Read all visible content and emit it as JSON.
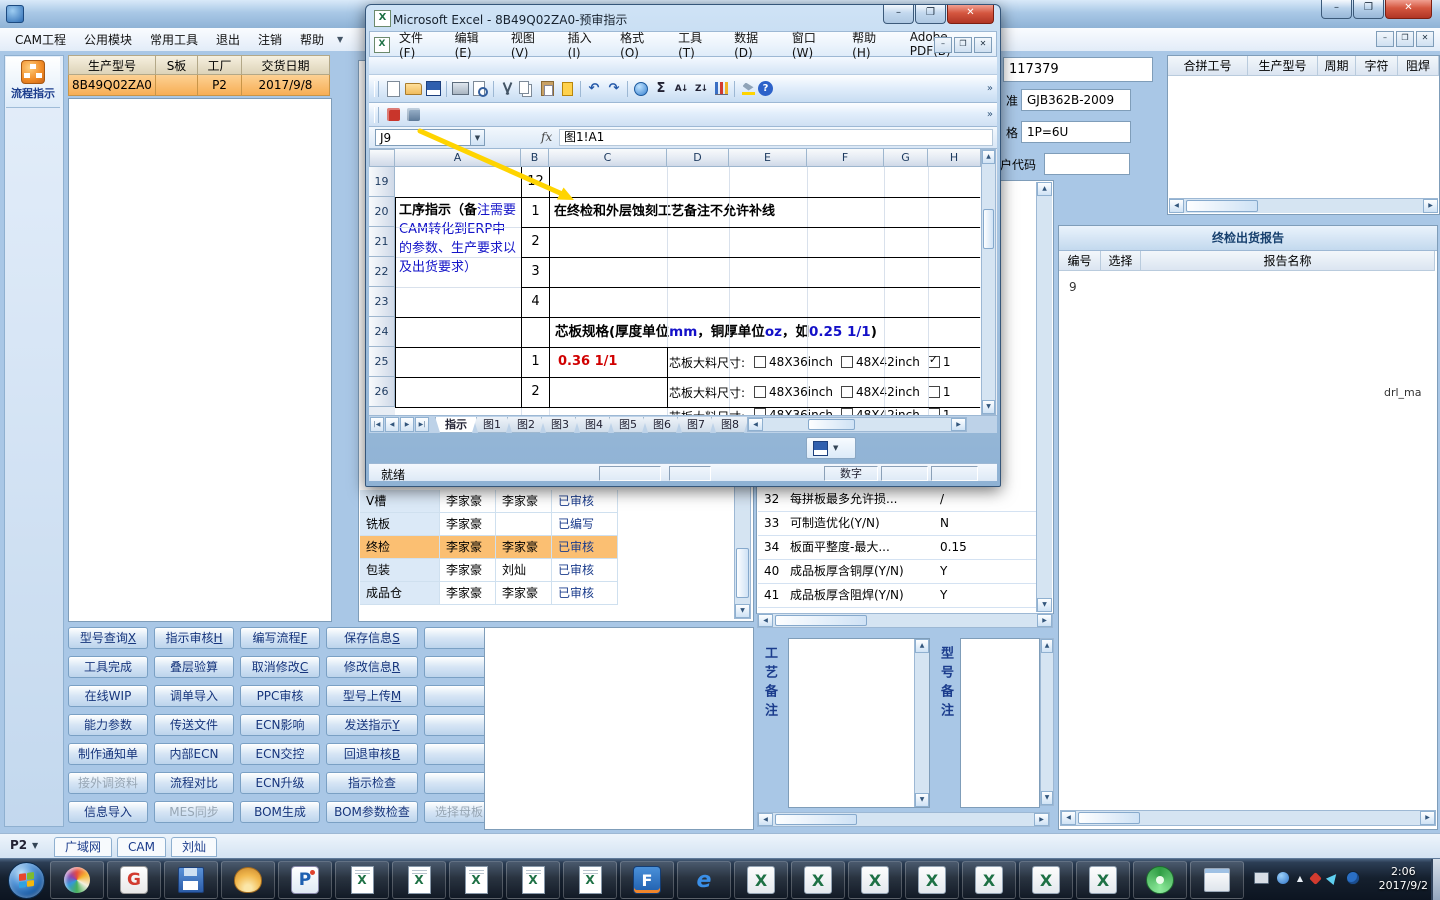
{
  "app": {
    "window_buttons": {
      "minimize": "–",
      "maximize": "❐",
      "close": "✕"
    },
    "menu": [
      "CAM工程",
      "公用模块",
      "常用工具",
      "退出",
      "注销",
      "帮助"
    ],
    "sidebar_flow_label": "流程指示",
    "order_table": {
      "headers": [
        "生产型号",
        "S板",
        "工厂",
        "交货日期"
      ],
      "row": {
        "model": "8B49Q02ZA0",
        "s_board": "",
        "factory": "P2",
        "delivery_date": "2017/9/8"
      }
    },
    "process_table": {
      "rows": [
        {
          "step": "V槽",
          "writer": "李家豪",
          "auditor": "李家豪",
          "status": "已审核",
          "highlight": false
        },
        {
          "step": "铣板",
          "writer": "李家豪",
          "auditor": "",
          "status": "已编写",
          "highlight": false
        },
        {
          "step": "终检",
          "writer": "李家豪",
          "auditor": "李家豪",
          "status": "已审核",
          "highlight": true
        },
        {
          "step": "包装",
          "writer": "李家豪",
          "auditor": "刘灿",
          "status": "已审核",
          "highlight": false
        },
        {
          "step": "成品仓",
          "writer": "李家豪",
          "auditor": "李家豪",
          "status": "已审核",
          "highlight": false
        }
      ]
    },
    "params_table": {
      "rows": [
        {
          "no": "32",
          "name": "每拼板最多允许损...",
          "value": "/"
        },
        {
          "no": "33",
          "name": "可制造优化(Y/N)",
          "value": "N"
        },
        {
          "no": "34",
          "name": "板面平整度-最大...",
          "value": "0.15"
        },
        {
          "no": "40",
          "name": "成品板厚含铜厚(Y/N)",
          "value": "Y"
        },
        {
          "no": "41",
          "name": "成品板厚含阻焊(Y/N)",
          "value": "Y"
        }
      ]
    },
    "fields": {
      "order_no": "117379",
      "standard_label": "准",
      "standard_value": "GJB362B-2009",
      "spec_label": "格",
      "spec_value": "1P=6U",
      "customer_label": "户代码",
      "customer_value": ""
    },
    "merge_table_headers": [
      "合拼工号",
      "生产型号",
      "周期",
      "字符",
      "阻焊"
    ],
    "report_panel": {
      "title": "终检出货报告",
      "headers": [
        "编号",
        "选择",
        "报告名称"
      ],
      "fragment_no": "9",
      "fragment_name": "drl_ma"
    },
    "buttons": [
      [
        "型号查询X",
        "指示审核H",
        "编写流程F",
        "保存信息S",
        ""
      ],
      [
        "工具完成",
        "叠层验算",
        "取消修改C",
        "修改信息R",
        ""
      ],
      [
        "在线WIP",
        "调单导入",
        "PPC审核",
        "型号上传M",
        ""
      ],
      [
        "能力参数",
        "传送文件",
        "ECN影响",
        "发送指示Y",
        ""
      ],
      [
        "制作通知单",
        "内部ECN",
        "ECN交控",
        "回退审核B",
        ""
      ],
      [
        "接外调资料",
        "流程对比",
        "ECN升级",
        "指示检查",
        ""
      ],
      [
        "信息导入",
        "MES同步",
        "BOM生成",
        "BOM参数检查",
        "选择母板"
      ]
    ],
    "disabled_buttons": [
      "接外调资料",
      "MES同步",
      "选择母板"
    ],
    "remark_labels": {
      "process": "工艺备注",
      "model": "型号备注"
    },
    "bottom_bar": {
      "site": "P2",
      "tabs": [
        "广域网",
        "CAM",
        "刘灿"
      ]
    }
  },
  "excel": {
    "title": "Microsoft Excel - 8B49Q02ZA0-预审指示",
    "menus": [
      "文件(F)",
      "编辑(E)",
      "视图(V)",
      "插入(I)",
      "格式(O)",
      "工具(T)",
      "数据(D)",
      "窗口(W)",
      "帮助(H)",
      "Adobe PDF(B)"
    ],
    "toolbar_icons": [
      {
        "n": "new"
      },
      {
        "n": "open"
      },
      {
        "n": "save"
      },
      {
        "n": "sep"
      },
      {
        "n": "print"
      },
      {
        "n": "print-preview"
      },
      {
        "n": "sep"
      },
      {
        "n": "cut"
      },
      {
        "n": "copy"
      },
      {
        "n": "paste"
      },
      {
        "n": "format-painter"
      },
      {
        "n": "sep"
      },
      {
        "n": "undo",
        "g": "↶"
      },
      {
        "n": "redo",
        "g": "↷"
      },
      {
        "n": "sep"
      },
      {
        "n": "hyperlink"
      },
      {
        "n": "autosum",
        "g": "Σ"
      },
      {
        "n": "sort-asc",
        "g": "A↓"
      },
      {
        "n": "sort-desc",
        "g": "Z↓"
      },
      {
        "n": "chart-wizard"
      },
      {
        "n": "sep"
      },
      {
        "n": "fill-color"
      },
      {
        "n": "help",
        "g": "?"
      }
    ],
    "pdf_toolbar": [
      {
        "n": "pdf-convert"
      },
      {
        "n": "pdf-email"
      }
    ],
    "name_box": "J9",
    "fx_label": "fx",
    "formula": "图1!A1",
    "columns": [
      "A",
      "B",
      "C",
      "D",
      "E",
      "F",
      "G",
      "H"
    ],
    "rows": [
      "19",
      "20",
      "21",
      "22",
      "23",
      "24",
      "25",
      "26"
    ],
    "cells": {
      "b19": "12",
      "a20_part1": "工序指示（备",
      "a20_part2": "注需要CAM转化到ERP中的参数、生产要求以及出货要求）",
      "b20": "1",
      "b21": "2",
      "b22": "3",
      "b23": "4",
      "c20": "在终检和外层蚀刻工艺备注不允许补线",
      "r24_parts": [
        {
          "t": "芯板规格(厚度单位",
          "c": "black"
        },
        {
          "t": "mm",
          "c": "blue"
        },
        {
          "t": "，铜厚单位",
          "c": "black"
        },
        {
          "t": "oz",
          "c": "blue"
        },
        {
          "t": "，如",
          "c": "black"
        },
        {
          "t": "0.25 1/1",
          "c": "blue"
        },
        {
          "t": ")",
          "c": "black"
        }
      ],
      "b25": "1",
      "c25": "0.36 1/1",
      "b26": "2",
      "size_row": {
        "label": "芯板大料尺寸:",
        "opt1": "48X36inch",
        "opt2": "48X42inch",
        "opt3": "1"
      },
      "row25_opt3_checked": true,
      "row26_opt3_checked": false
    },
    "sheet_tabs": [
      "指示",
      "图1",
      "图2",
      "图3",
      "图4",
      "图5",
      "图6",
      "图7",
      "图8"
    ],
    "status": {
      "left": "就绪",
      "mode": "数字"
    }
  },
  "taskbar": {
    "icons": [
      {
        "name": "browser-sphere-icon",
        "cls": "ic-sphere"
      },
      {
        "name": "g-app-icon",
        "cls": "ic-g",
        "glyph": "G"
      },
      {
        "name": "floppy-app-icon",
        "cls": "ic-floppy"
      },
      {
        "name": "shell-app-icon",
        "cls": "ic-shell"
      },
      {
        "name": "p-app-icon",
        "cls": "ic-p",
        "glyph": "P"
      },
      {
        "name": "excel-doc-icon",
        "cls": "ic-xldoc",
        "glyph": "X"
      },
      {
        "name": "excel-doc-icon",
        "cls": "ic-xldoc",
        "glyph": "X"
      },
      {
        "name": "excel-doc-icon",
        "cls": "ic-xldoc",
        "glyph": "X"
      },
      {
        "name": "excel-doc-icon",
        "cls": "ic-xldoc",
        "glyph": "X"
      },
      {
        "name": "excel-doc-icon",
        "cls": "ic-xldoc",
        "glyph": "X"
      },
      {
        "name": "flashfxp-icon",
        "cls": "ic-f",
        "glyph": "F"
      },
      {
        "name": "ie-icon",
        "cls": "ic-ie",
        "glyph": "e"
      },
      {
        "name": "excel-app-icon",
        "cls": "ic-xlapp",
        "glyph": "X"
      },
      {
        "name": "excel-app-icon",
        "cls": "ic-xlapp",
        "glyph": "X"
      },
      {
        "name": "excel-app-icon",
        "cls": "ic-xlapp",
        "glyph": "X"
      },
      {
        "name": "excel-app-icon",
        "cls": "ic-xlapp",
        "glyph": "X"
      },
      {
        "name": "excel-app-icon",
        "cls": "ic-xlapp",
        "glyph": "X"
      },
      {
        "name": "excel-app-icon",
        "cls": "ic-xlapp",
        "glyph": "X"
      },
      {
        "name": "excel-app-icon",
        "cls": "ic-xlapp",
        "glyph": "X"
      },
      {
        "name": "green-swirl-icon",
        "cls": "ic-swirl"
      },
      {
        "name": "window-app-icon",
        "cls": "ic-win"
      }
    ],
    "tray_icons": [
      {
        "name": "printer-tray-icon",
        "cls": "t-card"
      },
      {
        "name": "blue-dot-tray-icon",
        "cls": "t-round"
      },
      {
        "name": "hidden-icons-arrow",
        "cls": "t-up",
        "glyph": "▲"
      },
      {
        "name": "red-tray-icon",
        "cls": "t-red"
      },
      {
        "name": "plane-tray-icon",
        "cls": "t-plane"
      },
      {
        "name": "globe-tray-icon",
        "cls": "t-globe"
      }
    ],
    "clock": {
      "time": "2:06",
      "date": "2017/9/2"
    }
  }
}
